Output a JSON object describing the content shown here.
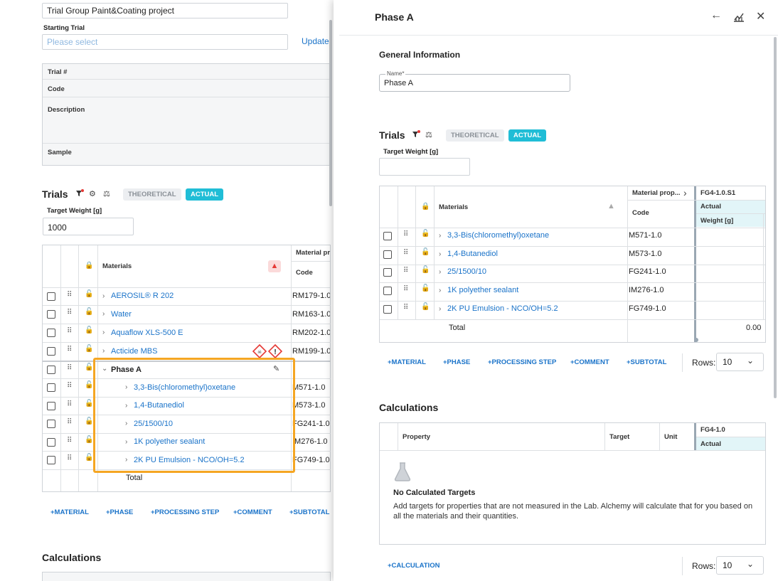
{
  "left": {
    "project_name": "Trial Group Paint&Coating project",
    "starting_trial_label": "Starting Trial",
    "starting_trial_placeholder": "Please select",
    "update_label": "Update",
    "info_rows": [
      "Trial #",
      "Code",
      "Description",
      "Sample"
    ],
    "trials_title": "Trials",
    "theoretical": "THEORETICAL",
    "actual": "ACTUAL",
    "target_weight_label": "Target Weight [g]",
    "target_weight_value": "1000",
    "col_materials": "Materials",
    "col_material_prop": "Material pro",
    "col_code": "Code",
    "rows": [
      {
        "name": "AEROSIL® R 202",
        "code": "RM179-1.0"
      },
      {
        "name": "Water",
        "code": "RM163-1.0"
      },
      {
        "name": "Aquaflow XLS-500 E",
        "code": "RM202-1.0"
      },
      {
        "name": "Acticide MBS",
        "code": "RM199-1.0"
      }
    ],
    "phase_name": "Phase A",
    "phase_rows": [
      {
        "name": "3,3-Bis(chloromethyl)oxetane",
        "code": "M571-1.0"
      },
      {
        "name": "1,4-Butanediol",
        "code": "M573-1.0"
      },
      {
        "name": "25/1500/10",
        "code": "FG241-1.0"
      },
      {
        "name": "1K polyether sealant",
        "code": "IM276-1.0"
      },
      {
        "name": "2K PU Emulsion - NCO/OH=5.2",
        "code": "FG749-1.0"
      }
    ],
    "total_label": "Total",
    "actions": [
      "+MATERIAL",
      "+PHASE",
      "+PROCESSING STEP",
      "+COMMENT",
      "+SUBTOTAL"
    ],
    "calculations_title": "Calculations"
  },
  "panel": {
    "title": "Phase A",
    "general_info": "General Information",
    "name_label": "Name",
    "name_value": "Phase A",
    "trials_title": "Trials",
    "theoretical": "THEORETICAL",
    "actual": "ACTUAL",
    "target_weight_label": "Target Weight [g]",
    "target_weight_value": "",
    "col_materials": "Materials",
    "col_material_prop": "Material prop...",
    "col_code": "Code",
    "col_trial": "FG4-1.0.S1",
    "col_actual": "Actual",
    "col_weight": "Weight [g]",
    "rows": [
      {
        "name": "3,3-Bis(chloromethyl)oxetane",
        "code": "M571-1.0"
      },
      {
        "name": "1,4-Butanediol",
        "code": "M573-1.0"
      },
      {
        "name": "25/1500/10",
        "code": "FG241-1.0"
      },
      {
        "name": "1K polyether sealant",
        "code": "IM276-1.0"
      },
      {
        "name": "2K PU Emulsion - NCO/OH=5.2",
        "code": "FG749-1.0"
      }
    ],
    "total_label": "Total",
    "total_value": "0.00",
    "actions": [
      "+MATERIAL",
      "+PHASE",
      "+PROCESSING STEP",
      "+COMMENT",
      "+SUBTOTAL"
    ],
    "rows_label": "Rows:",
    "rows_value": "10",
    "calculations_title": "Calculations",
    "calc_cols": {
      "property": "Property",
      "target": "Target",
      "unit": "Unit",
      "trial": "FG4-1.0",
      "actual": "Actual"
    },
    "empty_title": "No Calculated Targets",
    "empty_text": "Add targets for properties that are not measured in the Lab. Alchemy will calculate that for you based on all the materials and their quantities.",
    "calc_action": "+CALCULATION",
    "calc_rows_label": "Rows:",
    "calc_rows_value": "10"
  },
  "colors": {
    "accent": "#1a73c9",
    "actual_pill": "#20bdd6",
    "highlight": "#f5a623",
    "warning": "#e53935"
  }
}
